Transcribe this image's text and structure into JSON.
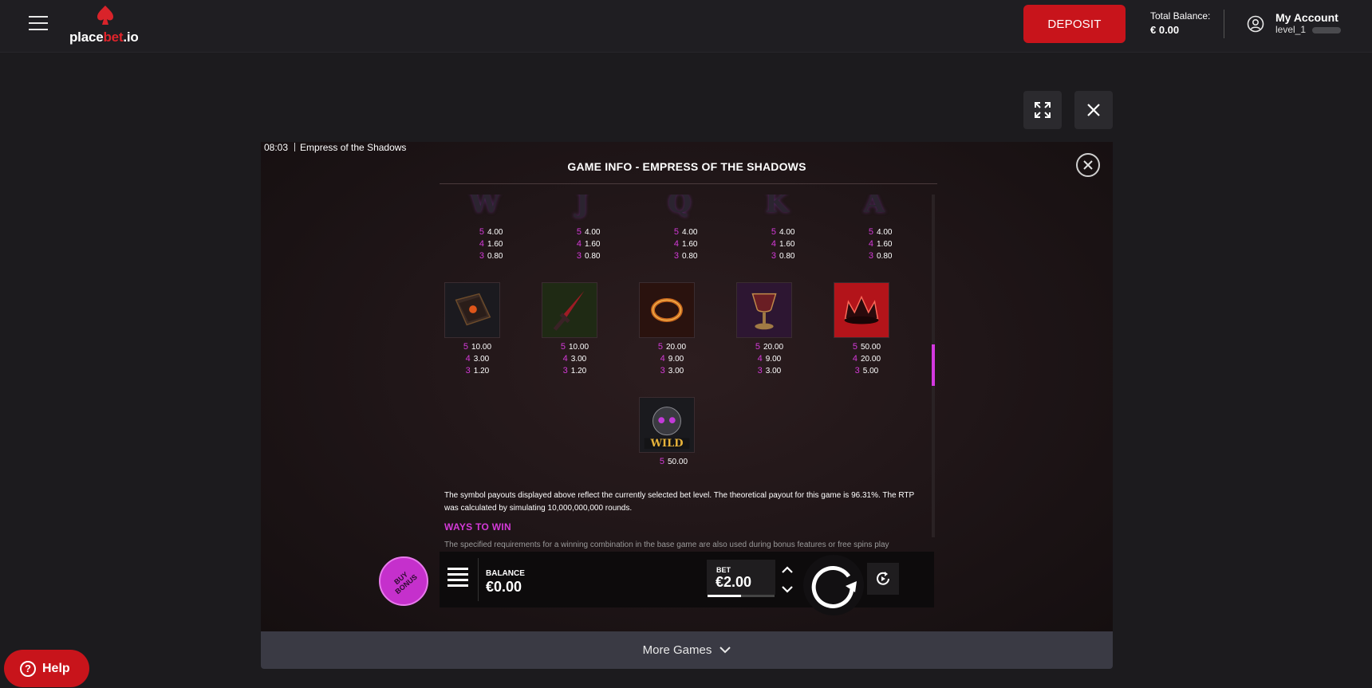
{
  "header": {
    "logo_text_white_1": "place",
    "logo_text_red": "bet",
    "logo_text_white_2": ".io",
    "deposit_label": "DEPOSIT",
    "balance_label": "Total Balance:",
    "balance_value": "€ 0.00",
    "account_name": "My Account",
    "account_level": "level_1"
  },
  "game": {
    "time": "08:03",
    "title": "Empress of the Shadows",
    "info_title": "GAME INFO - EMPRESS OF THE SHADOWS",
    "letter_symbols": [
      {
        "glyph": "W",
        "payouts": [
          {
            "n": "5",
            "v": "4.00"
          },
          {
            "n": "4",
            "v": "1.60"
          },
          {
            "n": "3",
            "v": "0.80"
          }
        ]
      },
      {
        "glyph": "J",
        "payouts": [
          {
            "n": "5",
            "v": "4.00"
          },
          {
            "n": "4",
            "v": "1.60"
          },
          {
            "n": "3",
            "v": "0.80"
          }
        ]
      },
      {
        "glyph": "Q",
        "payouts": [
          {
            "n": "5",
            "v": "4.00"
          },
          {
            "n": "4",
            "v": "1.60"
          },
          {
            "n": "3",
            "v": "0.80"
          }
        ]
      },
      {
        "glyph": "K",
        "payouts": [
          {
            "n": "5",
            "v": "4.00"
          },
          {
            "n": "4",
            "v": "1.60"
          },
          {
            "n": "3",
            "v": "0.80"
          }
        ]
      },
      {
        "glyph": "A",
        "payouts": [
          {
            "n": "5",
            "v": "4.00"
          },
          {
            "n": "4",
            "v": "1.60"
          },
          {
            "n": "3",
            "v": "0.80"
          }
        ]
      }
    ],
    "image_symbols": [
      {
        "name": "book",
        "payouts": [
          {
            "n": "5",
            "v": "10.00"
          },
          {
            "n": "4",
            "v": "3.00"
          },
          {
            "n": "3",
            "v": "1.20"
          }
        ]
      },
      {
        "name": "dagger",
        "payouts": [
          {
            "n": "5",
            "v": "10.00"
          },
          {
            "n": "4",
            "v": "3.00"
          },
          {
            "n": "3",
            "v": "1.20"
          }
        ]
      },
      {
        "name": "thorn-crown",
        "payouts": [
          {
            "n": "5",
            "v": "20.00"
          },
          {
            "n": "4",
            "v": "9.00"
          },
          {
            "n": "3",
            "v": "3.00"
          }
        ]
      },
      {
        "name": "chalice",
        "payouts": [
          {
            "n": "5",
            "v": "20.00"
          },
          {
            "n": "4",
            "v": "9.00"
          },
          {
            "n": "3",
            "v": "3.00"
          }
        ]
      },
      {
        "name": "crown",
        "payouts": [
          {
            "n": "5",
            "v": "50.00"
          },
          {
            "n": "4",
            "v": "20.00"
          },
          {
            "n": "3",
            "v": "5.00"
          }
        ]
      }
    ],
    "wild_symbol": {
      "label": "WILD",
      "payout_n": "5",
      "payout_v": "50.00"
    },
    "rtp_text": "The symbol payouts displayed above reflect the currently selected bet level. The theoretical payout for this game is 96.31%. The RTP was calculated by simulating 10,000,000,000 rounds.",
    "ways_title": "WAYS TO WIN",
    "ways_text": "The specified requirements for a winning combination in the base game are also used during bonus features or free spins play",
    "buy_bonus_label": "BUY BONUS",
    "balance_label": "BALANCE",
    "balance_value": "€0.00",
    "bet_label": "BET",
    "bet_value": "€2.00",
    "bet_level_fraction": 0.5
  },
  "footer": {
    "more_games_label": "More Games",
    "help_label": "Help"
  },
  "colors": {
    "brand_red": "#c8141b",
    "accent_magenta": "#d43ad8"
  }
}
